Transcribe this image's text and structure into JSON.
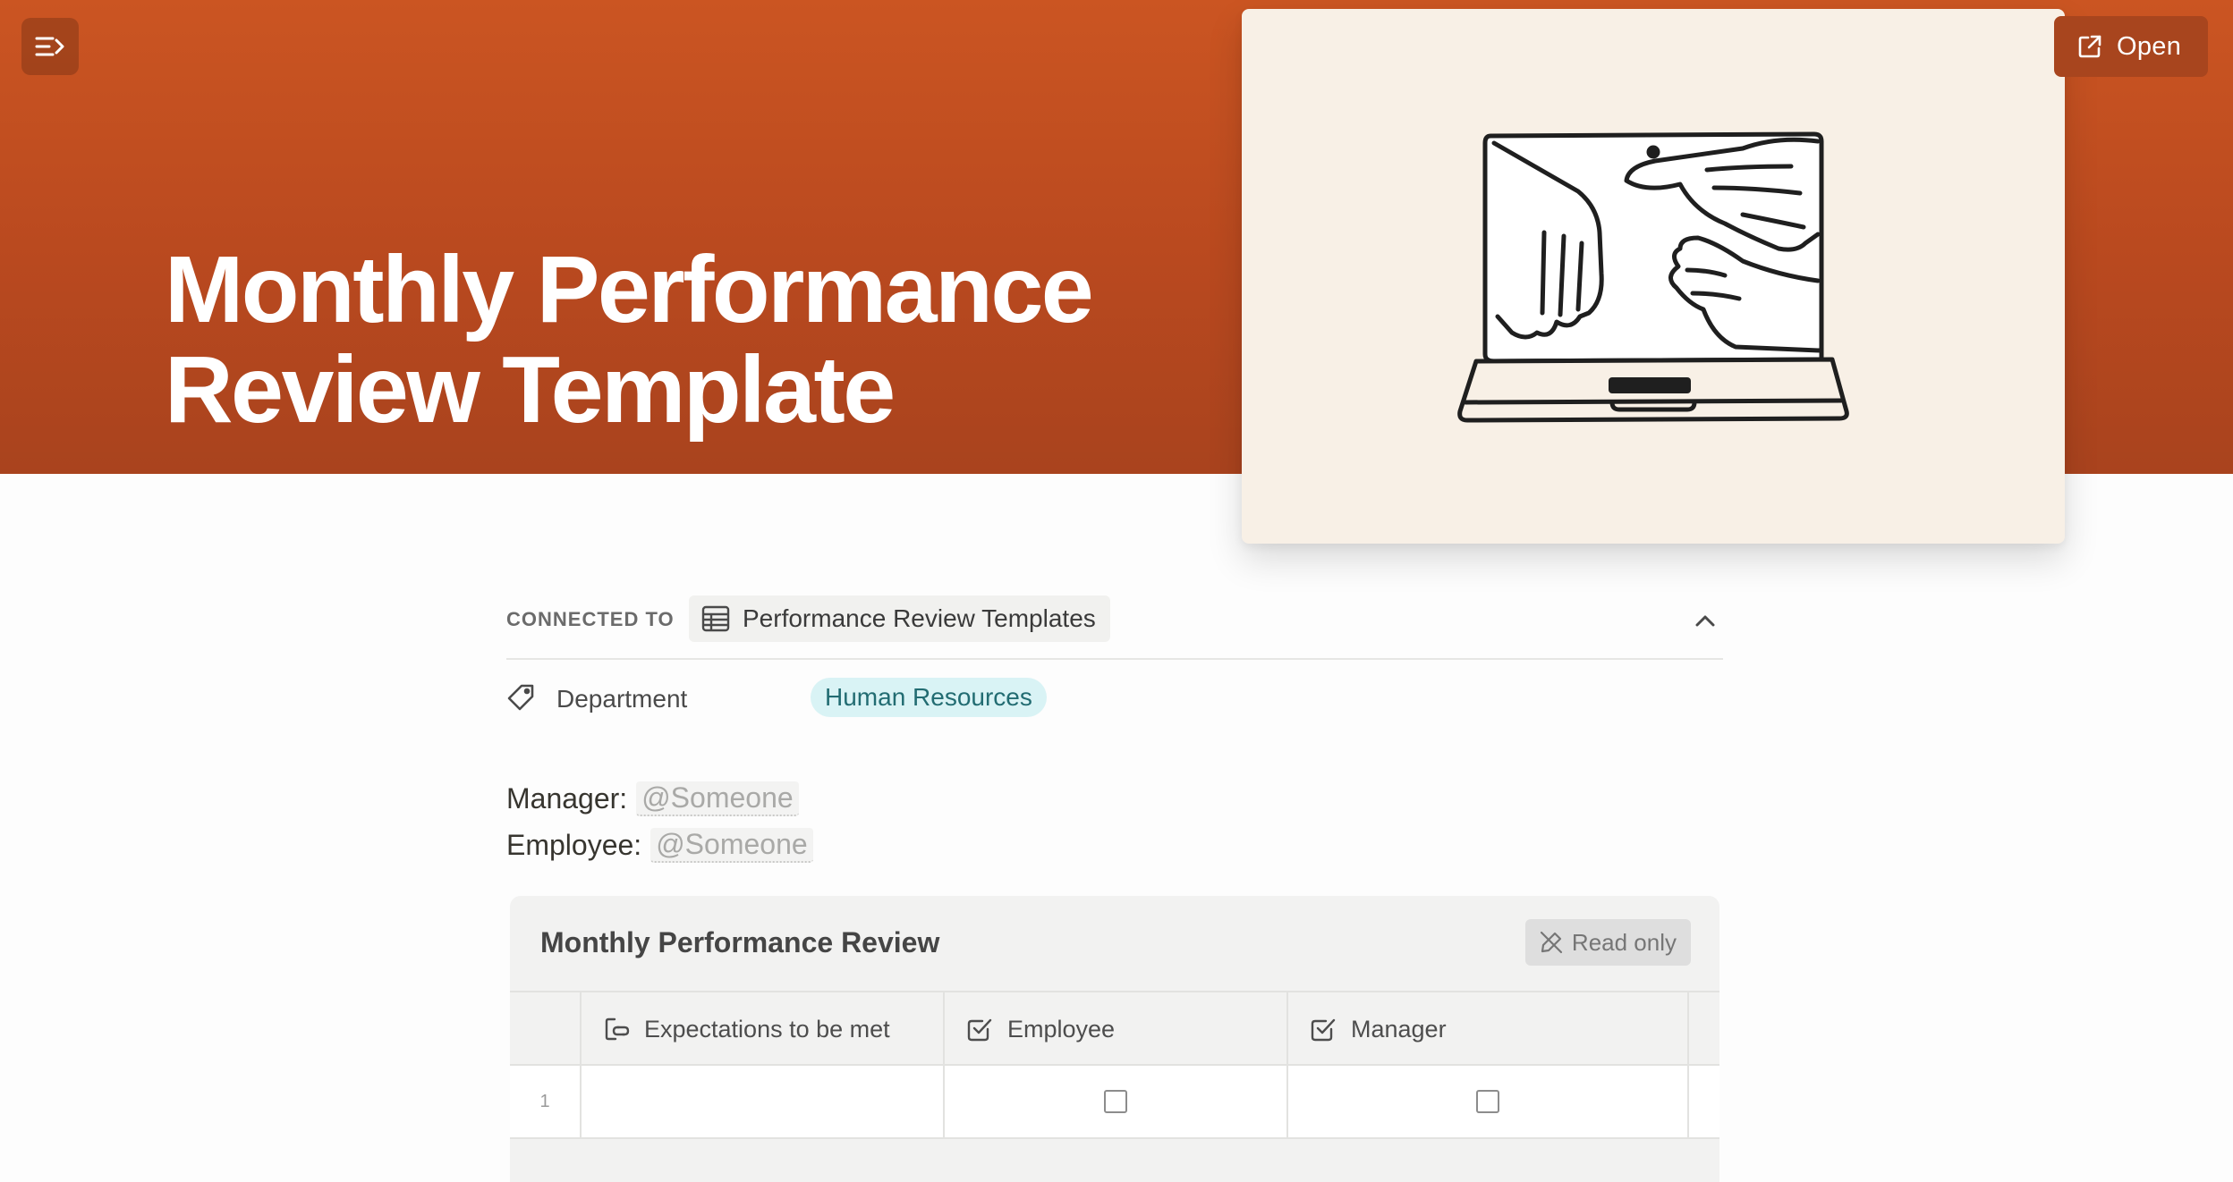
{
  "header": {
    "title": "Monthly Performance Review Template",
    "open_label": "Open",
    "banner_color": "#c4501f"
  },
  "icons": {
    "sidebar_toggle": "sidebar-toggle-icon",
    "open": "external-link-icon",
    "database": "table-icon",
    "collapse": "chevron-up-icon",
    "department": "tag-icon",
    "read_only": "pencil-slash-icon",
    "expectations": "link-icon",
    "employee": "checkbox-icon",
    "manager": "checkbox-icon"
  },
  "properties": {
    "connected_label": "CONNECTED TO",
    "database_name": "Performance Review Templates",
    "department": {
      "name": "Department",
      "value": "Human Resources",
      "tag_color": "#d9f3f5"
    }
  },
  "body": {
    "manager_label": "Manager:",
    "manager_mention": "@Someone",
    "employee_label": "Employee:",
    "employee_mention": "@Someone"
  },
  "table": {
    "title": "Monthly Performance Review",
    "read_only_label": "Read only",
    "columns": [
      "Expectations to be met",
      "Employee",
      "Manager"
    ],
    "rows": [
      {
        "number": "1",
        "expectation": "",
        "employee_checked": false,
        "manager_checked": false
      }
    ]
  }
}
